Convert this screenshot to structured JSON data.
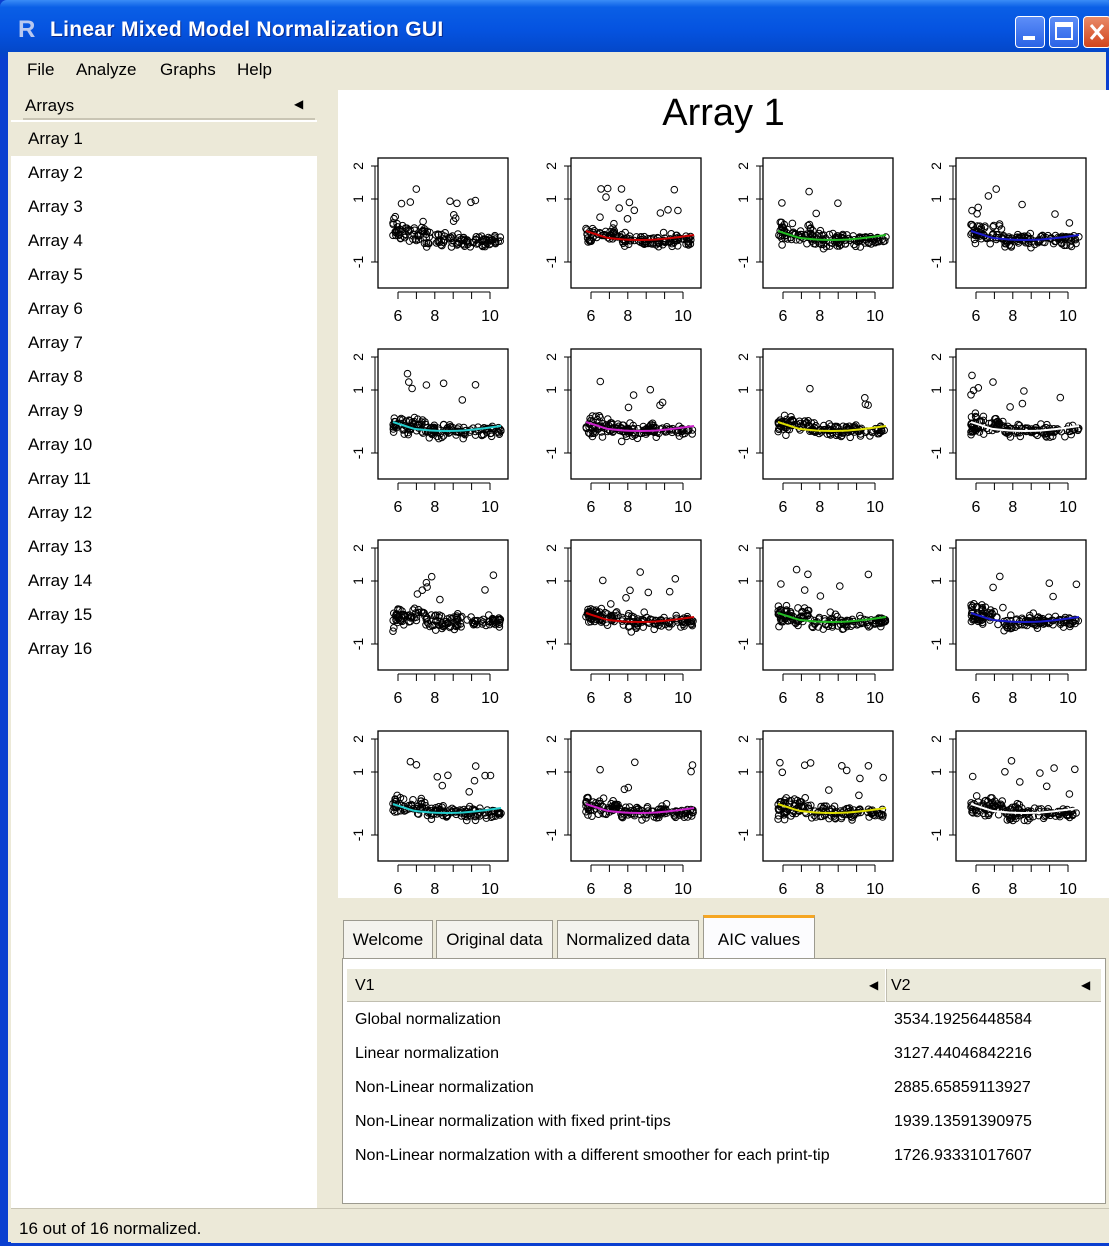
{
  "window": {
    "title": "Linear Mixed Model Normalization GUI",
    "icon_letter": "R"
  },
  "menu": [
    "File",
    "Analyze",
    "Graphs",
    "Help"
  ],
  "sidebar": {
    "header": "Arrays",
    "items": [
      "Array 1",
      "Array 2",
      "Array 3",
      "Array 4",
      "Array 5",
      "Array 6",
      "Array 7",
      "Array 8",
      "Array 9",
      "Array 10",
      "Array 11",
      "Array 12",
      "Array 13",
      "Array 14",
      "Array 15",
      "Array 16"
    ],
    "selected": 0
  },
  "plot": {
    "title": "Array 1",
    "x_ticks": [
      "6",
      "8",
      "10"
    ],
    "y_ticks": [
      "2",
      "1",
      "-1"
    ],
    "panel_colors": [
      "none",
      "#cc0000",
      "#22bb22",
      "#1a1acc",
      "#22cccc",
      "#cc22cc",
      "#dddd00",
      "#ffffff",
      "none",
      "#cc0000",
      "#22bb22",
      "#1a1acc",
      "#22cccc",
      "#cc22cc",
      "#dddd00",
      "#ffffff"
    ]
  },
  "tabs": {
    "items": [
      "Welcome",
      "Original data",
      "Normalized data",
      "AIC values"
    ],
    "active": 3
  },
  "aic_table": {
    "columns": [
      "V1",
      "V2"
    ],
    "rows": [
      [
        "Global normalization",
        "3534.19256448584"
      ],
      [
        "Linear normalization",
        "3127.44046842216"
      ],
      [
        "Non-Linear normalization",
        "2885.65859113927"
      ],
      [
        "Non-Linear normalization with fixed print-tips",
        "1939.13591390975"
      ],
      [
        "Non-Linear normalzation with a different smoother for each print-tip",
        "1726.93331017607"
      ]
    ]
  },
  "status": "16 out of 16 normalized."
}
